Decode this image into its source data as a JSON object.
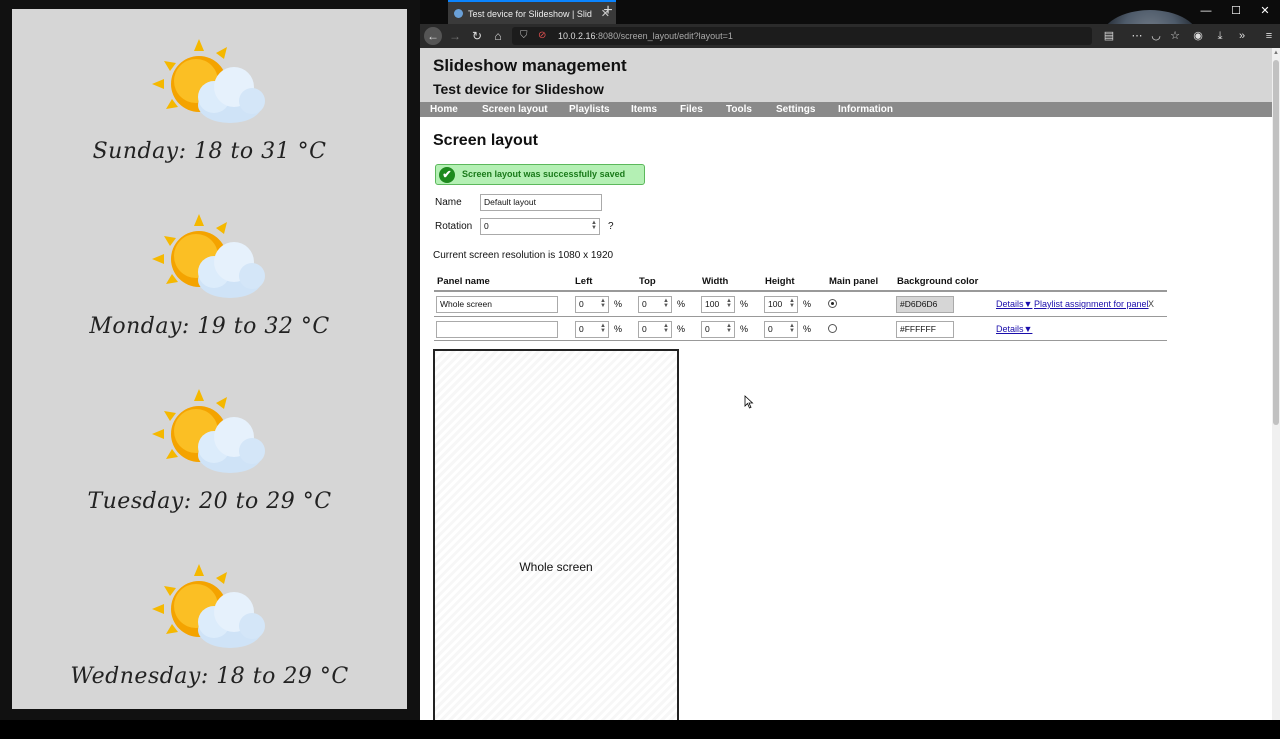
{
  "slideshow": {
    "days": [
      {
        "text": "Sunday: 18 to 31 °C"
      },
      {
        "text": "Monday: 19 to 32 °C"
      },
      {
        "text": "Tuesday: 20 to 29 °C"
      },
      {
        "text": "Wednesday: 18 to 29 °C"
      }
    ]
  },
  "browser": {
    "tab_title": "Test device for Slideshow | Slid",
    "url_host": "10.0.2.16",
    "url_path": ":8080/screen_layout/edit?layout=1"
  },
  "header": {
    "site_title": "Slideshow management",
    "device_title": "Test device for Slideshow"
  },
  "menu": [
    "Home",
    "Screen layout",
    "Playlists",
    "Items",
    "Files",
    "Tools",
    "Settings",
    "Information"
  ],
  "main": {
    "section_title": "Screen layout",
    "success_message": "Screen layout was successfully saved",
    "name_label": "Name",
    "name_value": "Default layout",
    "rotation_label": "Rotation",
    "rotation_value": "0",
    "rotation_help": "?",
    "resolution_text": "Current screen resolution is 1080 x 1920"
  },
  "table": {
    "headers": [
      "Panel name",
      "Left",
      "Top",
      "Width",
      "Height",
      "Main panel",
      "Background color"
    ],
    "pct": "%",
    "rows": [
      {
        "name": "Whole screen",
        "left": "0",
        "top": "0",
        "width": "100",
        "height": "100",
        "main": true,
        "bg": "#D6D6D6",
        "details": "Details▼",
        "assign": "Playlist assignment for panel",
        "delete": "X"
      },
      {
        "name": "",
        "left": "0",
        "top": "0",
        "width": "0",
        "height": "0",
        "main": false,
        "bg": "#FFFFFF",
        "details": "Details▼"
      }
    ]
  },
  "preview": {
    "label": "Whole screen"
  },
  "colors": {
    "header_bg": "#d6d6d6",
    "menu_bg": "#8a8a8a",
    "success_bg": "#b4f0b4",
    "slide_bg": "#d6d6d6"
  }
}
